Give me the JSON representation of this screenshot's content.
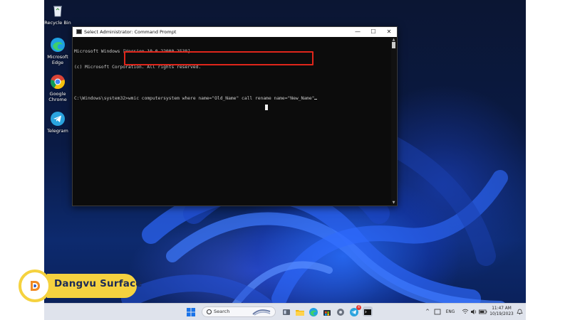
{
  "desktop": {
    "icons": [
      {
        "label": "Recycle Bin",
        "icon": "recycle-bin-icon"
      },
      {
        "label": "Microsoft Edge",
        "label_lines": [
          "Microsoft",
          "Edge"
        ],
        "icon": "edge-icon"
      },
      {
        "label": "Google Chrome",
        "label_lines": [
          "Google",
          "Chrome"
        ],
        "icon": "chrome-icon"
      },
      {
        "label": "Telegram",
        "icon": "telegram-icon"
      }
    ]
  },
  "cmd_window": {
    "title": "Select Administrator: Command Prompt",
    "controls": {
      "minimize": "—",
      "maximize": "☐",
      "close": "✕"
    },
    "lines": [
      "Microsoft Windows [Version 10.0.22000.2538]",
      "(c) Microsoft Corporation. All rights reserved.",
      "",
      "C:\\Windows\\system32>wmic computersystem where name=\"Old_Name\" call rename name=\"New_Name\""
    ],
    "prompt": "C:\\Windows\\system32>",
    "command": "wmic computersystem where name=\"Old_Name\" call rename name=\"New_Name\"",
    "highlight_color": "#e0261b"
  },
  "taskbar": {
    "search_label": "Search",
    "apps": [
      "windows-start-icon",
      "search-icon",
      "widgets-icon",
      "file-explorer-icon",
      "folder-icon",
      "edge-icon",
      "store-icon",
      "settings-icon",
      "telegram-icon",
      "terminal-icon"
    ],
    "telegram_badge": "4",
    "tray": {
      "chevron": "^",
      "language": "ENG",
      "time": "11:47 AM",
      "date": "10/19/2023"
    }
  },
  "watermark": {
    "brand": "Dangvu Surface",
    "accent": "#f5d23f",
    "text_color": "#1b2a57"
  }
}
